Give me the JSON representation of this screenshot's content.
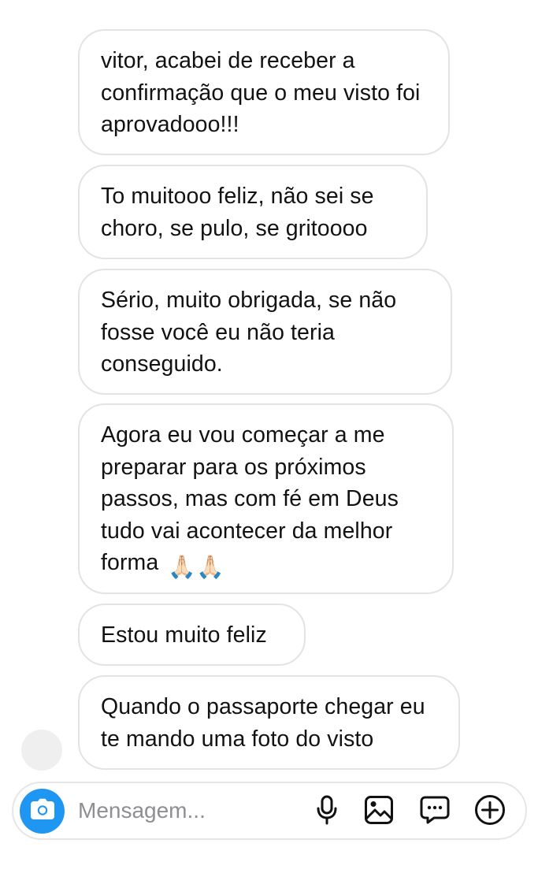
{
  "messages": [
    {
      "text": "vitor, acabei de receber a confirmação que o meu visto foi aprovadooo!!!"
    },
    {
      "text": "To muitooo feliz, não sei se choro, se pulo, se gritoooo"
    },
    {
      "text": "Sério, muito obrigada, se não fosse você eu não teria conseguido."
    },
    {
      "text": "Agora eu vou começar a me preparar para os próximos passos, mas com fé em Deus tudo vai acontecer da melhor forma",
      "emoji": "🙏🏻🙏🏻"
    },
    {
      "text": "Estou muito feliz"
    },
    {
      "text": "Quando o passaporte chegar eu te mando uma foto do visto"
    }
  ],
  "composer": {
    "placeholder": "Mensagem...",
    "value": ""
  },
  "icons": {
    "camera": "camera-icon",
    "microphone": "microphone-icon",
    "gallery": "gallery-icon",
    "sticker": "sticker-icon",
    "plus": "plus-circle-icon"
  },
  "colors": {
    "camera_button": "#2096f3",
    "bubble_border": "#e3e3e6",
    "placeholder": "#8e8e93",
    "avatar_placeholder": "#efefef"
  }
}
